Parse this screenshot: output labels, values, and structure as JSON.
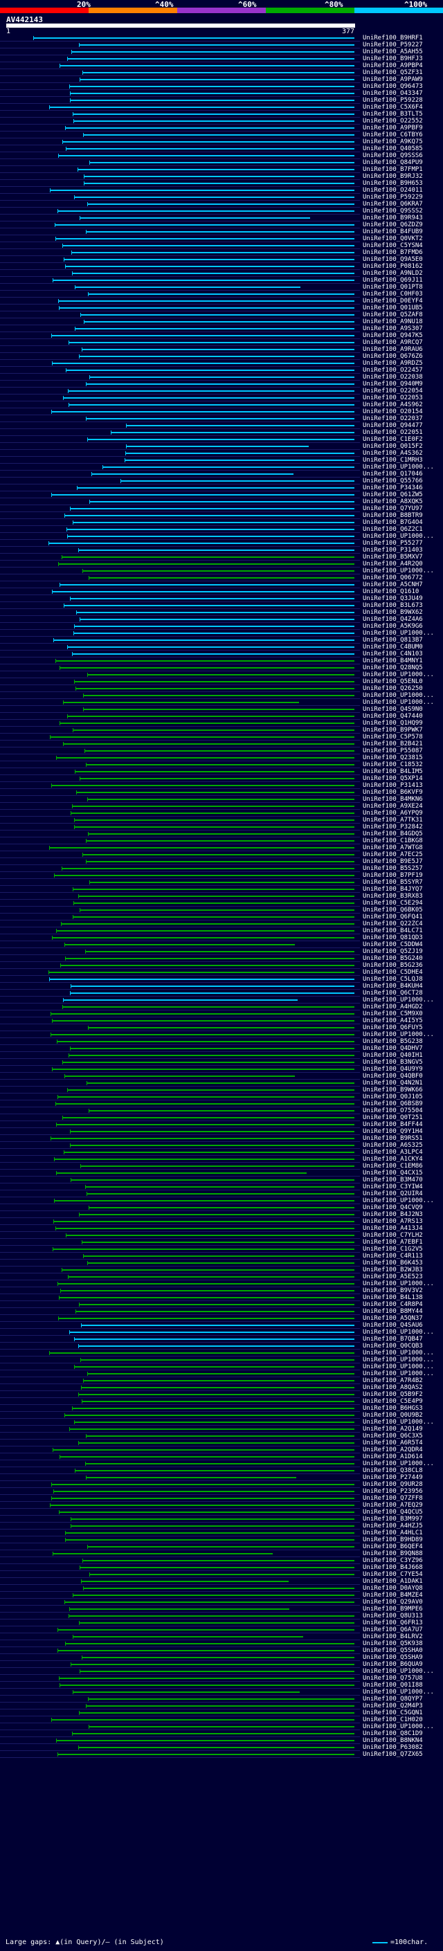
{
  "scale": {
    "labels": [
      "20%",
      "^40%",
      "^60%",
      "^80%",
      "^100%"
    ],
    "colors": [
      "#ff0000",
      "#ff8000",
      "#9933cc",
      "#00aa00",
      "#00c8ff"
    ]
  },
  "query": {
    "name": "AV442143",
    "start": "1",
    "end": "377"
  },
  "footer": {
    "legend_text": "Large gaps: ▲(in Query)/— (in Subject)",
    "scale_text": "=100char."
  },
  "colors": {
    "cyan": "#00c8ff",
    "green": "#00aa00",
    "background": "#000033"
  },
  "hits": [
    "UniRef100_B9HRF1",
    "UniRef100_P59227",
    "UniRef100_A5AH55",
    "UniRef100_B9HFJ3",
    "UniRef100_A9PBP4",
    "UniRef100_Q5ZF31",
    "UniRef100_A9PAW9",
    "UniRef100_Q96473",
    "UniRef100_O43347",
    "UniRef100_P59228",
    "UniRef100_C5X6F4",
    "UniRef100_B3TLT5",
    "UniRef100_O22552",
    "UniRef100_A9PBF9",
    "UniRef100_C6TBY6",
    "UniRef100_A9KQ75",
    "UniRef100_Q40585",
    "UniRef100_Q9SSS6",
    "UniRef100_Q84PU9",
    "UniRef100_B7FMP1",
    "UniRef100_B9RJ32",
    "UniRef100_B9H653",
    "UniRef100_O24011",
    "UniRef100_P59229",
    "UniRef100_Q6KRA7",
    "UniRef100_Q9SSS2",
    "UniRef100_B9R943",
    "UniRef100_Q6ZDZ9",
    "UniRef100_B4FUB9",
    "UniRef100_Q0VKT2",
    "UniRef100_C5YSN4",
    "UniRef100_B7FMD6",
    "UniRef100_Q9A5E0",
    "UniRef100_P08162",
    "UniRef100_A9NLD2",
    "UniRef100_Q69J11",
    "UniRef100_Q01PT8",
    "UniRef100_C0HF03",
    "UniRef100_D0EYF4",
    "UniRef100_Q01UB5",
    "UniRef100_Q5ZAF8",
    "UniRef100_A9NU18",
    "UniRef100_A9S307",
    "UniRef100_Q947K5",
    "UniRef100_A9RCQ7",
    "UniRef100_A9RAU6",
    "UniRef100_Q676Z6",
    "UniRef100_A9RDZ5",
    "UniRef100_O22457",
    "UniRef100_O22038",
    "UniRef100_Q940M9",
    "UniRef100_O22054",
    "UniRef100_O22053",
    "UniRef100_A4S962",
    "UniRef100_O20154",
    "UniRef100_O22037",
    "UniRef100_Q94477",
    "UniRef100_O22051",
    "UniRef100_C1E0F2",
    "UniRef100_Q015F2",
    "UniRef100_A4S362",
    "UniRef100_C1MRH3",
    "UniRef100_UP1000...",
    "UniRef100_Q17046",
    "UniRef100_Q55766",
    "UniRef100_P34346",
    "UniRef100_Q61ZW5",
    "UniRef100_A8XQK5",
    "UniRef100_Q7YU97",
    "UniRef100_B8BTR9",
    "UniRef100_B7G4O4",
    "UniRef100_Q6Z2C1",
    "UniRef100_UP1000...",
    "UniRef100_P55277",
    "UniRef100_P31403",
    "UniRef100_B5MXV7",
    "UniRef100_A4R2Q0",
    "UniRef100_UP1000...",
    "UniRef100_Q06772",
    "UniRef100_A5CNH7",
    "UniRef100_Q1610",
    "UniRef100_Q3JU49",
    "UniRef100_B3L673",
    "UniRef100_B9WX62",
    "UniRef100_Q4Z4A6",
    "UniRef100_A5K9G6",
    "UniRef100_UP1000...",
    "UniRef100_Q813B7",
    "UniRef100_C4BUM0",
    "UniRef100_C4N103",
    "UniRef100_B4MNY1",
    "UniRef100_Q28NQ5",
    "UniRef100_UP1000...",
    "UniRef100_Q5ENL0",
    "UniRef100_Q26250",
    "UniRef100_UP1000...",
    "UniRef100_UP1000...",
    "UniRef100_Q4S9N0",
    "UniRef100_Q47440",
    "UniRef100_Q1HQ99",
    "UniRef100_B9PWK7",
    "UniRef100_C5P578",
    "UniRef100_B2B421",
    "UniRef100_P55087",
    "UniRef100_Q23815",
    "UniRef100_C18532",
    "UniRef100_B4LIM5",
    "UniRef100_Q5XP14",
    "UniRef100_P31413",
    "UniRef100_B6KVF9",
    "UniRef100_B4MKN6",
    "UniRef100_A9XE24",
    "UniRef100_A6YPQ9",
    "UniRef100_A7TK31",
    "UniRef100_P32842",
    "UniRef100_B4GDQ5",
    "UniRef100_C1BKG8",
    "UniRef100_A7WTG8",
    "UniRef100_A7EC25",
    "UniRef100_B9E5J7",
    "UniRef100_B5S257",
    "UniRef100_B7PF19",
    "UniRef100_B5SYR7",
    "UniRef100_B4JYQ7",
    "UniRef100_B3RX83",
    "UniRef100_C5E294",
    "UniRef100_Q6BK05",
    "UniRef100_Q6FQ41",
    "UniRef100_Q22ZC4",
    "UniRef100_B4LC71",
    "UniRef100_Q81QD3",
    "UniRef100_C5DDW4",
    "UniRef100_Q5ZJ19",
    "UniRef100_B5G240",
    "UniRef100_B5G236",
    "UniRef100_C5DHE4",
    "UniRef100_C5LQJ8",
    "UniRef100_B4KUH4",
    "UniRef100_Q6CT28",
    "UniRef100_UP1000...",
    "UniRef100_A4HGD2",
    "UniRef100_C5M9X0",
    "UniRef100_A4I5Y5",
    "UniRef100_Q6FUY5",
    "UniRef100_UP1000...",
    "UniRef100_B5G238",
    "UniRef100_Q4DHV7",
    "UniRef100_Q40IH1",
    "UniRef100_B3NGV5",
    "UniRef100_Q4U9Y9",
    "UniRef100_Q4QBF0",
    "UniRef100_Q4N2N1",
    "UniRef100_B9WK66",
    "UniRef100_Q0J105",
    "UniRef100_Q6BSB9",
    "UniRef100_O75504",
    "UniRef100_Q0T251",
    "UniRef100_B4FF44",
    "UniRef100_Q9Y1H4",
    "UniRef100_B9RS51",
    "UniRef100_A6S325",
    "UniRef100_A3LPC4",
    "UniRef100_A1CKY4",
    "UniRef100_C1EM86",
    "UniRef100_Q4CX15",
    "UniRef100_B3M470",
    "UniRef100_C3YIW4",
    "UniRef100_Q2UIR4",
    "UniRef100_UP1000...",
    "UniRef100_Q4CVQ9",
    "UniRef100_B4J2N3",
    "UniRef100_A7RS13",
    "UniRef100_A413J4",
    "UniRef100_C7YLH2",
    "UniRef100_A7EBF1",
    "UniRef100_C1G2V5",
    "UniRef100_C4R113",
    "UniRef100_B6K453",
    "UniRef100_B2WJB3",
    "UniRef100_A5E523",
    "UniRef100_UP1000...",
    "UniRef100_B9V3V2",
    "UniRef100_B4L138",
    "UniRef100_C4R8P4",
    "UniRef100_B8MY44",
    "UniRef100_A5QN37",
    "UniRef100_Q4SAU6",
    "UniRef100_UP1000...",
    "UniRef100_B7QB47",
    "UniRef100_Q0CQB3",
    "UniRef100_UP1000...",
    "UniRef100_UP1000...",
    "UniRef100_UP1000...",
    "UniRef100_UP1000...",
    "UniRef100_A7R4B2",
    "UniRef100_A8QAS2",
    "UniRef100_Q5B9F2",
    "UniRef100_C5E4P9",
    "UniRef100_B6HGS3",
    "UniRef100_Q0U9B2",
    "UniRef100_UP1000...",
    "UniRef100_A2Q149",
    "UniRef100_Q6C3X5",
    "UniRef100_A6R5T4",
    "UniRef100_A2QDR4",
    "UniRef100_A1D614",
    "UniRef100_UP1000...",
    "UniRef100_Q38CL8",
    "UniRef100_P27449",
    "UniRef100_Q9UR28",
    "UniRef100_P23956",
    "UniRef100_Q7ZFF8",
    "UniRef100_A7EQ29",
    "UniRef100_Q4QCU5",
    "UniRef100_B3M997",
    "UniRef100_A4HZJ5",
    "UniRef100_A4HLC1",
    "UniRef100_B9HD89",
    "UniRef100_B6QEF4",
    "UniRef100_B9QN88",
    "UniRef100_C3YZ96",
    "UniRef100_B4J668",
    "UniRef100_C7YE54",
    "UniRef100_A1DAK1",
    "UniRef100_D0AYQ8",
    "UniRef100_B4MZE4",
    "UniRef100_Q29AV0",
    "UniRef100_B9MPE6",
    "UniRef100_Q8U313",
    "UniRef100_Q6FR13",
    "UniRef100_Q6A7U7",
    "UniRef100_B4LRV2",
    "UniRef100_Q5K938",
    "UniRef100_Q5SHA0",
    "UniRef100_Q5SHA9",
    "UniRef100_B6QUA9",
    "UniRef100_UP1000...",
    "UniRef100_Q757U8",
    "UniRef100_Q01I88",
    "UniRef100_UP1000...",
    "UniRef100_Q8QYP7",
    "UniRef100_Q2M4P3",
    "UniRef100_C5GQN1",
    "UniRef100_C1H020",
    "UniRef100_UP1000...",
    "UniRef100_Q8C1D9",
    "UniRef100_B8NKN4",
    "UniRef100_P63082",
    "UniRef100_Q7ZX65"
  ]
}
